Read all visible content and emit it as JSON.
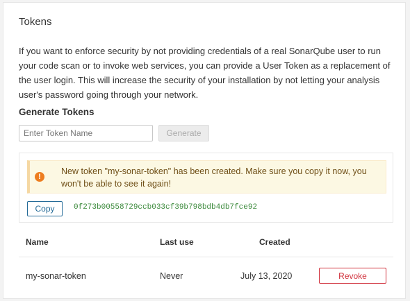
{
  "panel": {
    "title": "Tokens",
    "intro": "If you want to enforce security by not providing credentials of a real SonarQube user to run your code scan or to invoke web services, you can provide a User Token as a replacement of the user login. This will increase the security of your installation by not letting your analysis user's password going through your network."
  },
  "generate": {
    "section_title": "Generate Tokens",
    "input_placeholder": "Enter Token Name",
    "input_value": "",
    "button_label": "Generate",
    "button_disabled": true
  },
  "new_token": {
    "alert_icon": "exclamation-circle-icon",
    "alert_message": "New token \"my-sonar-token\" has been created. Make sure you copy it now, you won't be able to see it again!",
    "copy_label": "Copy",
    "token_value": "0f273b00558729ccb033cf39b798bdb4db7fce92"
  },
  "table": {
    "headers": {
      "name": "Name",
      "last_use": "Last use",
      "created": "Created"
    },
    "rows": [
      {
        "name": "my-sonar-token",
        "last_use": "Never",
        "created": "July 13, 2020",
        "action_label": "Revoke"
      }
    ]
  },
  "colors": {
    "alert_background": "#fcf8e3",
    "warning_icon": "#ed7d20",
    "primary": "#236a97",
    "danger": "#d02f3a",
    "token_text": "#3c8a3c"
  }
}
